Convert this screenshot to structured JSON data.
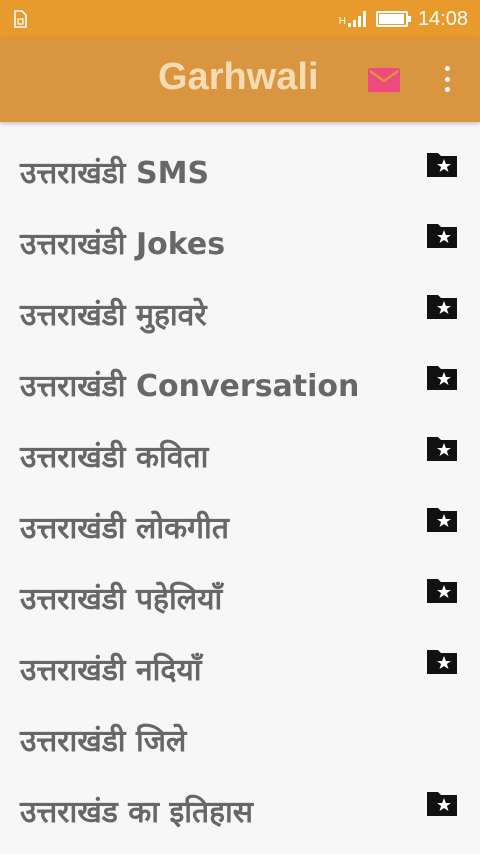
{
  "status_bar": {
    "time": "14:08",
    "network": "H",
    "sim_icon": "sim-card-icon",
    "signal_icon": "signal-icon",
    "battery_icon": "battery-icon"
  },
  "toolbar": {
    "title": "Garhwali",
    "mail_icon": "mail-icon",
    "menu_icon": "more-vert-icon",
    "mail_color": "#ef4a7f"
  },
  "colors": {
    "status_bar": "#e89a2c",
    "toolbar": "#d9953f",
    "title": "#f6dcb3",
    "row_text": "#676767"
  },
  "list": {
    "items": [
      {
        "label": "उत्तराखंडी SMS",
        "icon": "folder-star-icon"
      },
      {
        "label": "उत्तराखंडी Jokes",
        "icon": "folder-star-icon"
      },
      {
        "label": "उत्तराखंडी मुहावरे",
        "icon": "folder-star-icon"
      },
      {
        "label": "उत्तराखंडी Conversation",
        "icon": "folder-star-icon"
      },
      {
        "label": "उत्तराखंडी कविता",
        "icon": "folder-star-icon"
      },
      {
        "label": "उत्तराखंडी लोकगीत",
        "icon": "folder-star-icon"
      },
      {
        "label": "उत्तराखंडी पहेलियाँ",
        "icon": "folder-star-icon"
      },
      {
        "label": "उत्तराखंडी नदियाँ",
        "icon": "folder-star-icon"
      },
      {
        "label": "उत्तराखंडी जिले",
        "icon": ""
      },
      {
        "label": "उत्तराखंड का इतिहास",
        "icon": "folder-star-icon"
      }
    ]
  }
}
